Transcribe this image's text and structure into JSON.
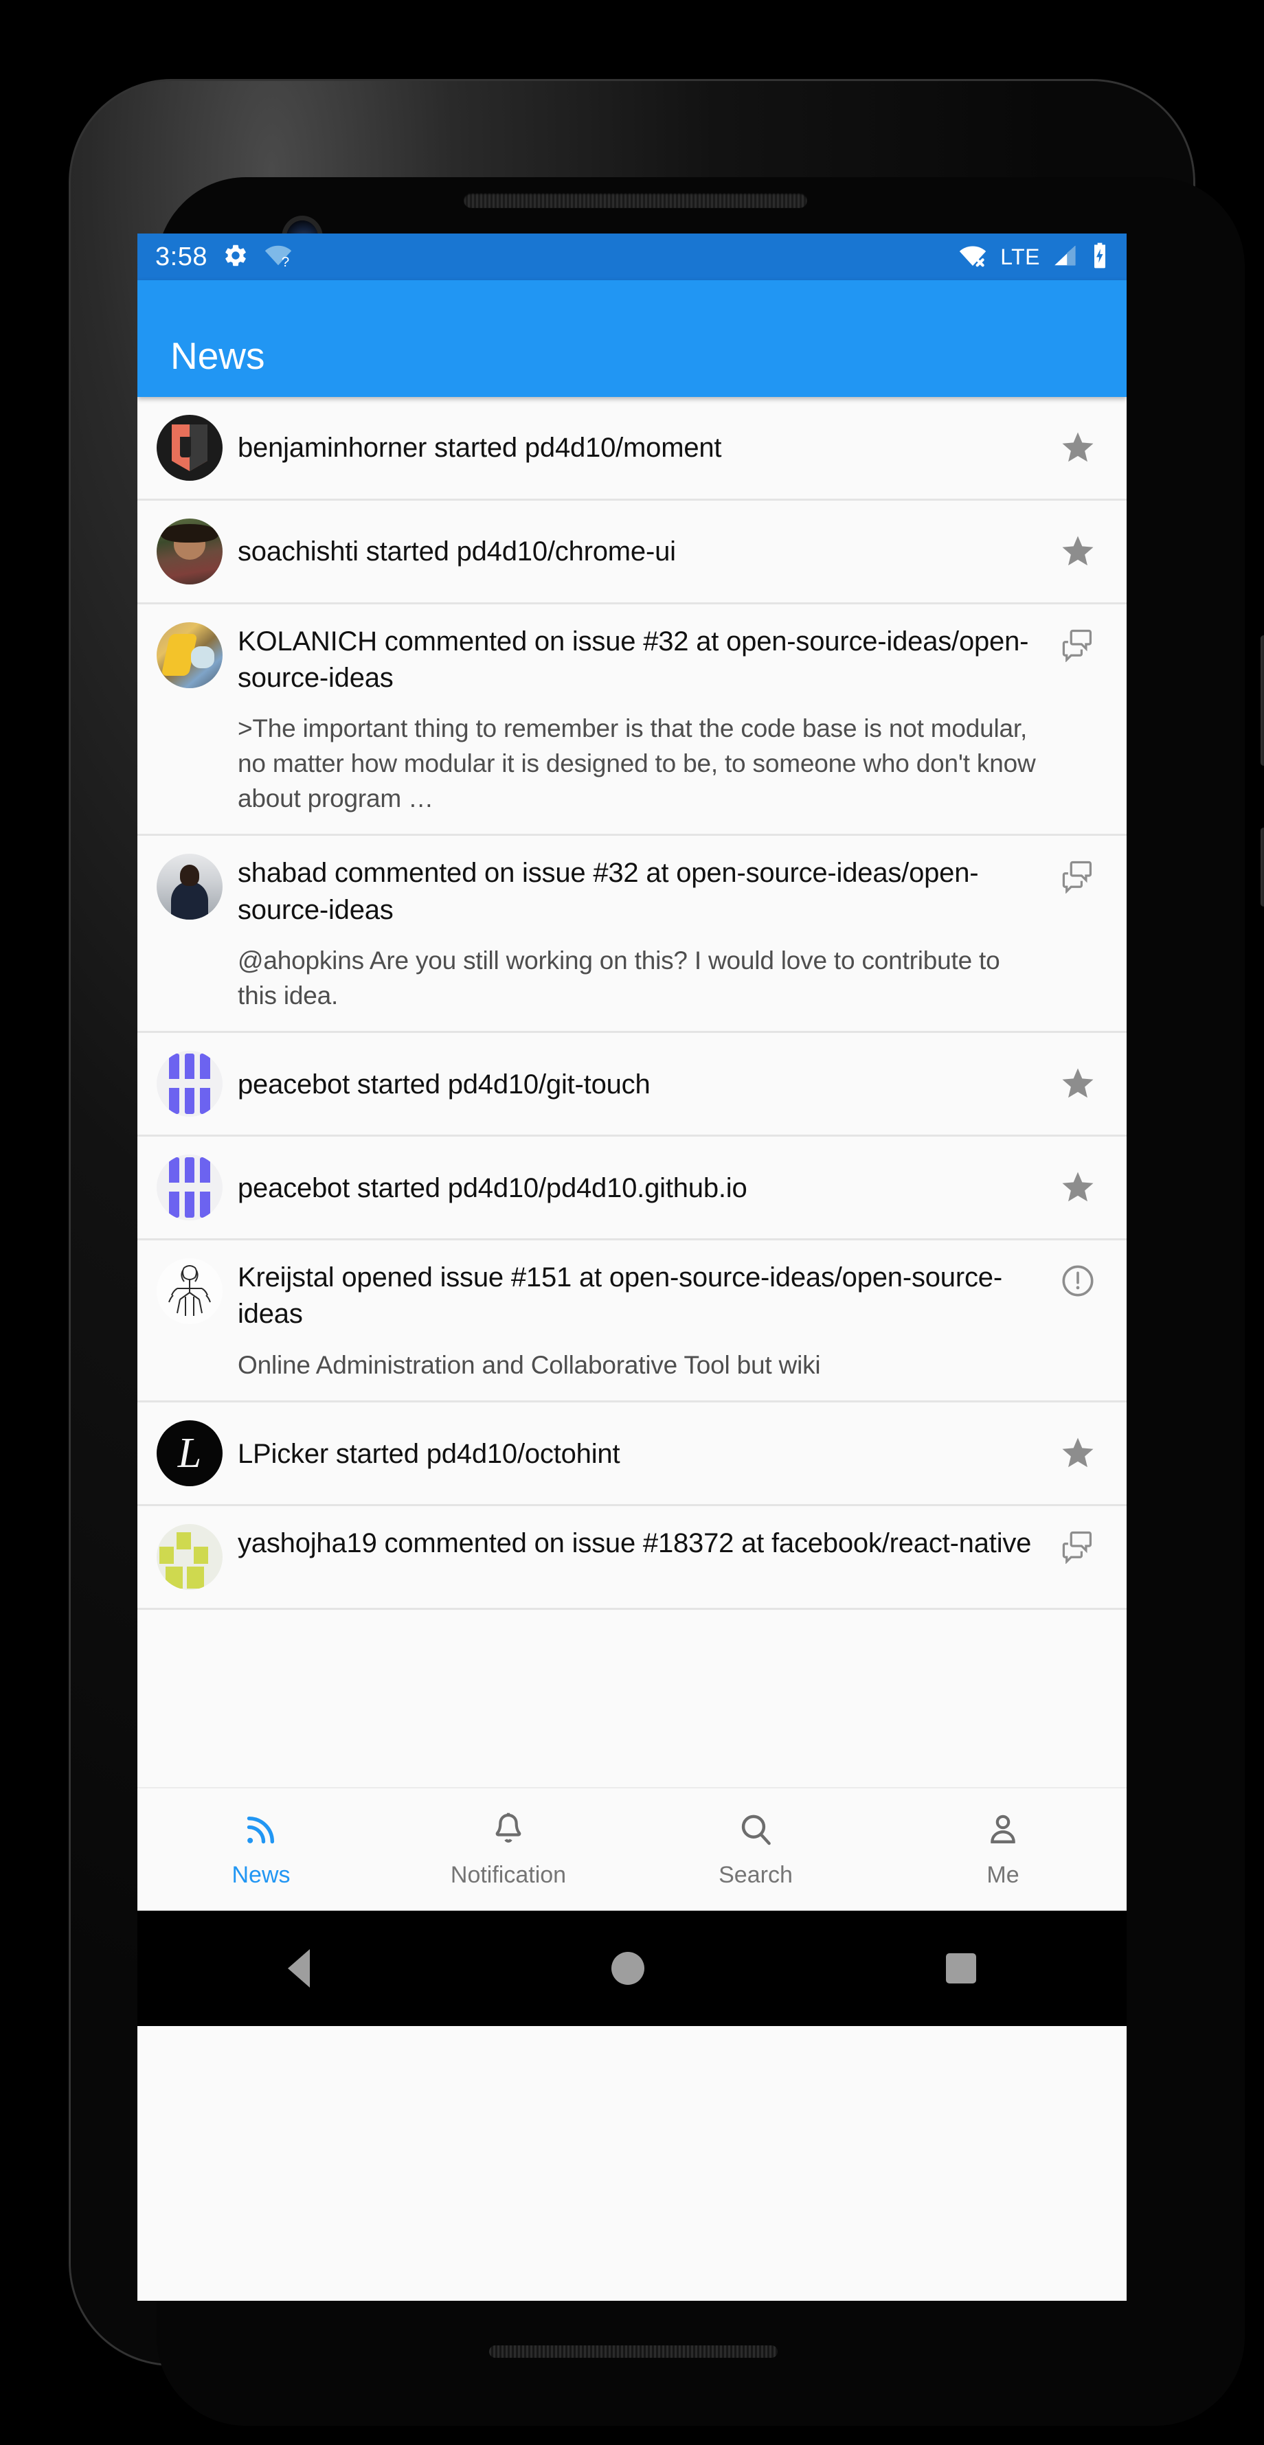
{
  "status_bar": {
    "time": "3:58",
    "left_icons": [
      "gear-icon",
      "wifi-question-icon"
    ],
    "network_label": "LTE",
    "right_icons": [
      "wifi-off-icon",
      "signal-bars-icon",
      "battery-charging-icon"
    ],
    "background_color": "#1976D2"
  },
  "app_bar": {
    "title": "News",
    "background_color": "#2196F3"
  },
  "feed": {
    "items": [
      {
        "avatar": "bolt-shield-logo",
        "title": "benjaminhorner started pd4d10/moment",
        "description": "",
        "action_icon": "star-icon",
        "layout": "compact"
      },
      {
        "avatar": "photo-man-outdoors",
        "title": "soachishti started pd4d10/chrome-ui",
        "description": "",
        "action_icon": "star-icon",
        "layout": "compact"
      },
      {
        "avatar": "photo-yellow-bird",
        "title": "KOLANICH commented on issue #32 at open-source-ideas/open-source-ideas",
        "description": ">The important thing to remember is that the code base is not modular, no matter how modular it is designed to be, to someone who don't know about program …",
        "action_icon": "comment-icon",
        "layout": "expanded"
      },
      {
        "avatar": "photo-man-suit",
        "title": "shabad commented on issue #32 at open-source-ideas/open-source-ideas",
        "description": "@ahopkins Are you still working on this? I would love to contribute to this idea.",
        "action_icon": "comment-icon",
        "layout": "expanded"
      },
      {
        "avatar": "peacebot-purple-bars",
        "title": "peacebot started pd4d10/git-touch",
        "description": "",
        "action_icon": "star-icon",
        "layout": "compact"
      },
      {
        "avatar": "peacebot-purple-bars",
        "title": "peacebot started pd4d10/pd4d10.github.io",
        "description": "",
        "action_icon": "star-icon",
        "layout": "compact"
      },
      {
        "avatar": "sketch-figure",
        "title": "Kreijstal opened issue #151 at open-source-ideas/open-source-ideas",
        "description": "Online Administration and Collaborative Tool but wiki",
        "action_icon": "exclamation-circle-icon",
        "layout": "expanded"
      },
      {
        "avatar": "black-script-l-logo",
        "title": "LPicker started pd4d10/octohint",
        "description": "",
        "action_icon": "star-icon",
        "layout": "compact"
      },
      {
        "avatar": "green-blocks-logo",
        "title": "yashojha19 commented on issue #18372 at facebook/react-native",
        "description": "",
        "action_icon": "comment-icon",
        "layout": "expanded"
      }
    ]
  },
  "bottom_nav": {
    "active_color": "#2196F3",
    "inactive_color": "#757575",
    "items": [
      {
        "label": "News",
        "icon": "rss-icon",
        "active": true
      },
      {
        "label": "Notification",
        "icon": "bell-icon",
        "active": false
      },
      {
        "label": "Search",
        "icon": "magnifier-icon",
        "active": false
      },
      {
        "label": "Me",
        "icon": "person-icon",
        "active": false
      }
    ]
  },
  "android_nav": {
    "buttons": [
      "back-triangle",
      "home-circle",
      "recents-square"
    ]
  }
}
